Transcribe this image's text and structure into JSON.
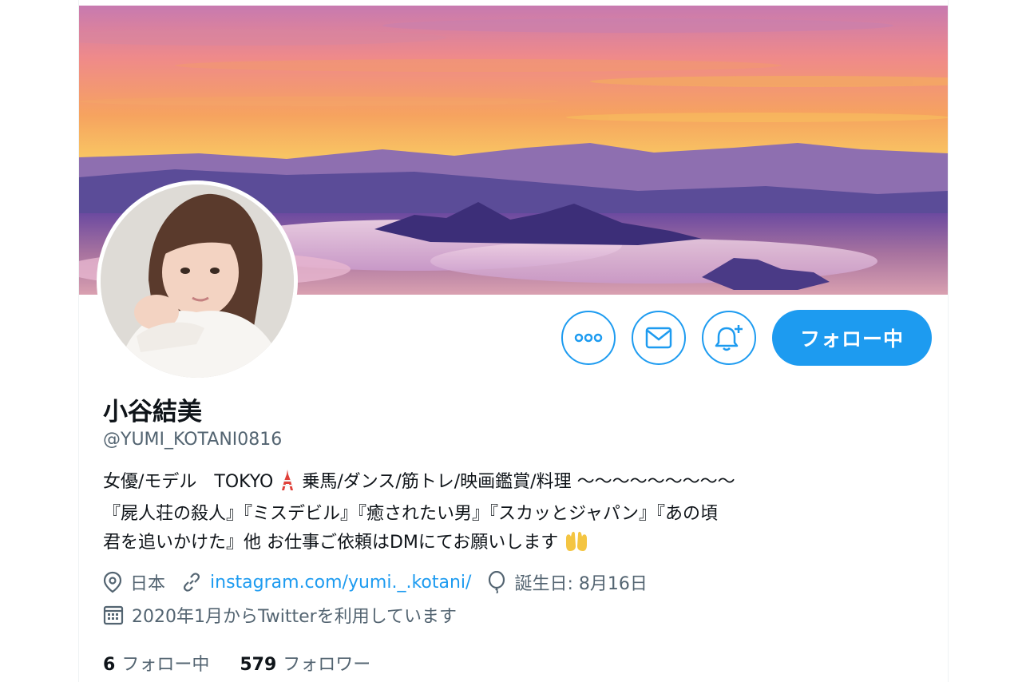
{
  "profile": {
    "display_name": "小谷結美",
    "handle": "@YUMI_KOTANI0816",
    "bio_lines": [
      "女優/モデル　TOKYO",
      " 乗馬/ダンス/筋トレ/映画鑑賞/料理 〜〜〜〜〜〜〜〜〜",
      "『屍人荘の殺人』『ミスデビル』『癒されたい男』『スカッとジャパン』『あの頃",
      "君を追いかけた』他 お仕事ご依頼はDMにてお願いします"
    ],
    "location": "日本",
    "website": "instagram.com/yumi._.kotani/",
    "birthday": "誕生日: 8月16日",
    "joined": "2020年1月からTwitterを利用しています",
    "following_count": "6",
    "following_label": "フォロー中",
    "followers_count": "579",
    "followers_label": "フォロワー"
  },
  "actions": {
    "following_button": "フォロー中"
  },
  "icons": {
    "more": "more-icon",
    "message": "mail-icon",
    "notify": "bell-plus-icon",
    "location": "location-pin-icon",
    "link": "link-icon",
    "birthday": "balloon-icon",
    "joined": "calendar-icon",
    "tokyo": "tokyo-tower-emoji",
    "hands": "palms-up-emoji"
  },
  "colors": {
    "accent": "#1d9bf0",
    "secondary_text": "#536471",
    "primary_text": "#0f1419"
  }
}
